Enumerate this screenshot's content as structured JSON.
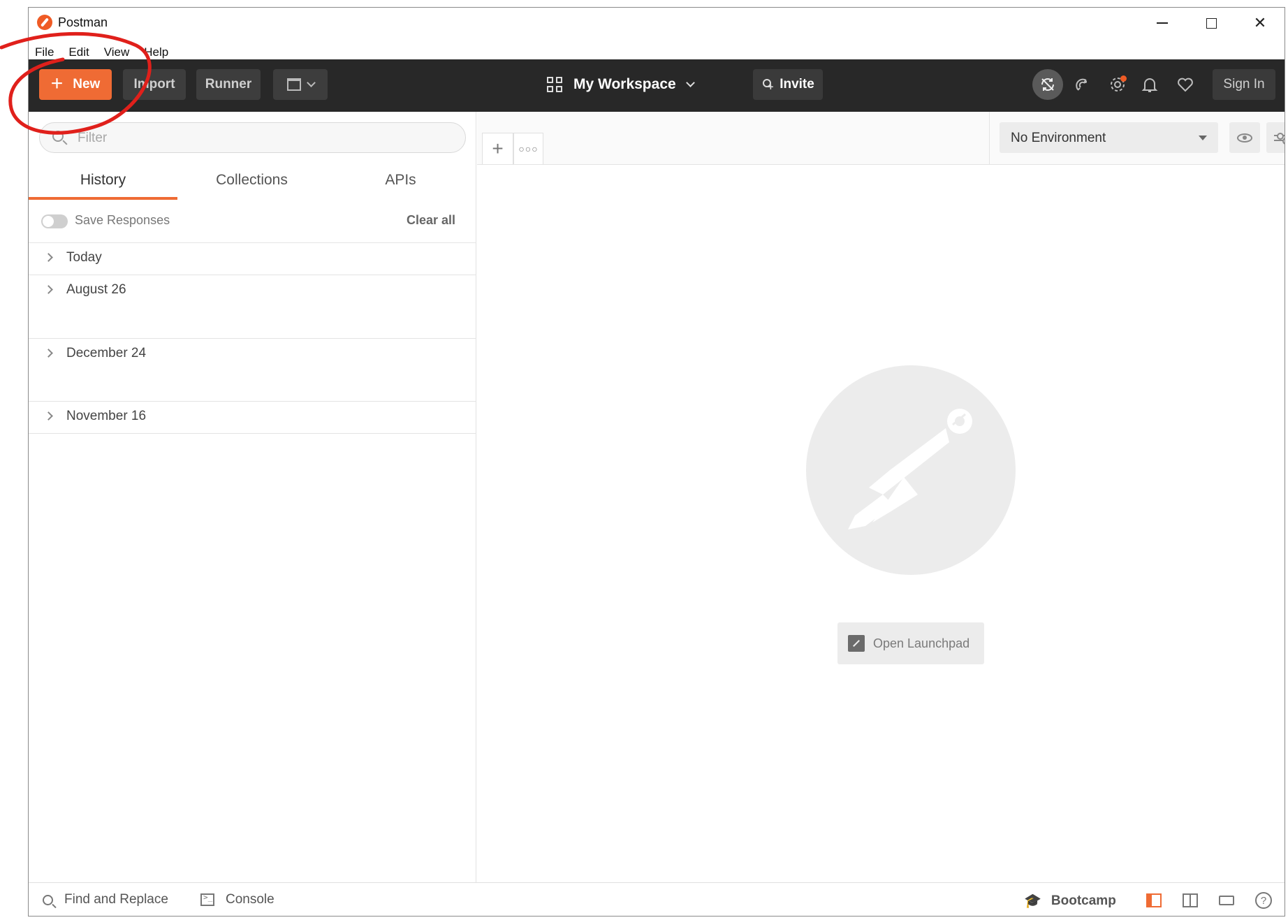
{
  "window": {
    "title": "Postman",
    "controls": {
      "minimize": "minimize",
      "maximize": "maximize",
      "close": "✕"
    }
  },
  "menubar": {
    "items": [
      "File",
      "Edit",
      "View",
      "Help"
    ]
  },
  "toolbar": {
    "new_label": "New",
    "import_label": "Import",
    "runner_label": "Runner",
    "workspace_label": "My Workspace",
    "invite_label": "Invite",
    "signin_label": "Sign In",
    "icons": [
      "sync-off-icon",
      "satellite-icon",
      "gear-icon",
      "bell-icon",
      "heart-icon"
    ],
    "settings_has_notification": true,
    "accent_color": "#ef6b34"
  },
  "sidebar": {
    "filter_placeholder": "Filter",
    "tabs": [
      {
        "label": "History",
        "active": true
      },
      {
        "label": "Collections",
        "active": false
      },
      {
        "label": "APIs",
        "active": false
      }
    ],
    "save_responses_label": "Save Responses",
    "save_responses_on": false,
    "clear_all_label": "Clear all",
    "history_groups": [
      "Today",
      "August 26",
      "December 24",
      "November 16"
    ]
  },
  "main": {
    "environment_label": "No Environment",
    "launchpad_label": "Open Launchpad"
  },
  "footer": {
    "find_replace_label": "Find and Replace",
    "console_label": "Console",
    "bootcamp_label": "Bootcamp"
  },
  "annotation": {
    "color": "#e0201b"
  }
}
